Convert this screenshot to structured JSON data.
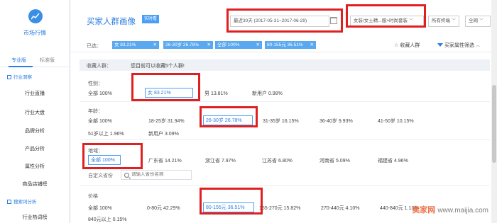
{
  "sidebar": {
    "title": "市场行情",
    "tabs": [
      "专业版",
      "标准版"
    ],
    "groups": [
      {
        "label": "行业洞察"
      },
      {
        "label": "搜索词分析"
      }
    ],
    "items": [
      "行业直播",
      "行业大盘",
      "品牌分析",
      "产品分析",
      "属性分析",
      "商品店铺榜",
      "行业热词榜"
    ]
  },
  "header": {
    "title": "买家人群画像",
    "badge": "实时看",
    "date_range": "最近30天 (2017-05-31~2017-06-29)",
    "category": "女装/女士精...服>时尚套装",
    "terminal": "所有终端",
    "network": "全网"
  },
  "selected": {
    "label": "已选：",
    "chips": [
      "女 83.21%",
      "26-30岁 26.78%",
      "全部 100%",
      "80-155元 36.51%"
    ],
    "favorite": "收藏人群",
    "filter": "买家属性筛选"
  },
  "hint": {
    "label": "收藏人群：",
    "text": "您目前可以收藏5个人群!"
  },
  "gender": {
    "label": "性别：",
    "options": [
      "全部 100%",
      "女 83.21%",
      "男 13.81%",
      "新用户 0.98%"
    ]
  },
  "age": {
    "label": "年龄：",
    "options": [
      "全部 100%",
      "18-25岁 31.94%",
      "26-30岁 26.78%",
      "31-35岁 16.15%",
      "36-40岁 9.93%",
      "41-50岁 10.15%",
      "51岁以上 1.96%",
      "新用户 3.09%"
    ]
  },
  "region": {
    "label": "地域：",
    "options": [
      "全部 100%",
      "广东省 14.21%",
      "浙江省 7.97%",
      "江苏省 6.80%",
      "河南省 5.09%",
      "福建省 4.96%"
    ]
  },
  "custom": {
    "label": "自定义省份",
    "placeholder": "请输入省份名称"
  },
  "price": {
    "label": "价格",
    "options": [
      "全部 100%",
      "0-80元 42.29%",
      "80-155元 36.51%",
      "155-270元 15.82%",
      "270-440元 4.10%",
      "440-840元 1.13%",
      "840元以上 0.15%"
    ]
  },
  "watermark": {
    "brand": "卖家网",
    "url": "www.maijia.com"
  },
  "colors": {
    "accent": "#2b7de0",
    "chip": "#5aa8f0",
    "highlight": "#e02020"
  }
}
